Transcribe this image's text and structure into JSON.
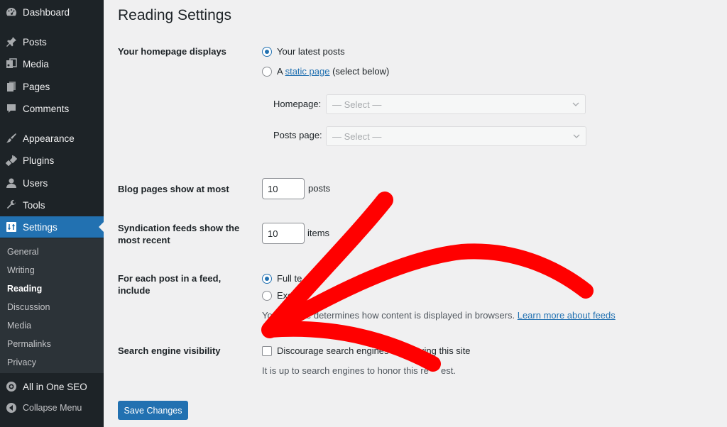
{
  "sidebar": {
    "menu": [
      {
        "label": "Dashboard",
        "icon": "dashboard-icon"
      },
      {
        "label": "Posts",
        "icon": "pin-icon"
      },
      {
        "label": "Media",
        "icon": "media-icon"
      },
      {
        "label": "Pages",
        "icon": "pages-icon"
      },
      {
        "label": "Comments",
        "icon": "comment-icon"
      },
      {
        "label": "Appearance",
        "icon": "brush-icon"
      },
      {
        "label": "Plugins",
        "icon": "plug-icon"
      },
      {
        "label": "Users",
        "icon": "user-icon"
      },
      {
        "label": "Tools",
        "icon": "wrench-icon"
      },
      {
        "label": "Settings",
        "icon": "settings-icon"
      }
    ],
    "submenu": [
      "General",
      "Writing",
      "Reading",
      "Discussion",
      "Media",
      "Permalinks",
      "Privacy"
    ],
    "seo": "All in One SEO",
    "collapse": "Collapse Menu"
  },
  "page": {
    "title": "Reading Settings"
  },
  "homepage_displays": {
    "label": "Your homepage displays",
    "opt_latest": "Your latest posts",
    "opt_static_prefix": "A",
    "opt_static_link": "static page",
    "opt_static_suffix": "(select below)",
    "homepage_label": "Homepage:",
    "homepage_value": "— Select —",
    "postspage_label": "Posts page:",
    "postspage_value": "— Select —"
  },
  "blog_pages": {
    "label": "Blog pages show at most",
    "value": "10",
    "unit": "posts"
  },
  "syndication": {
    "label": "Syndication feeds show the most recent",
    "value": "10",
    "unit": "items"
  },
  "feed_include": {
    "label": "For each post in a feed, include",
    "opt_full": "Full te",
    "opt_excerpt": "Exc",
    "desc_start": "Yo",
    "desc_mid": "e determines how content is displayed in browsers.",
    "desc_link": "Learn more about feeds"
  },
  "search_visibility": {
    "label": "Search engine visibility",
    "checkbox_label_a": "Discourage search engines fr",
    "checkbox_label_b": "xing this site",
    "desc_a": "It is up to search engines to honor this re",
    "desc_b": "est."
  },
  "save_button": "Save Changes",
  "colors": {
    "sidebar_bg": "#1d2327",
    "accent": "#2271b1",
    "arrow": "#ff0000"
  }
}
